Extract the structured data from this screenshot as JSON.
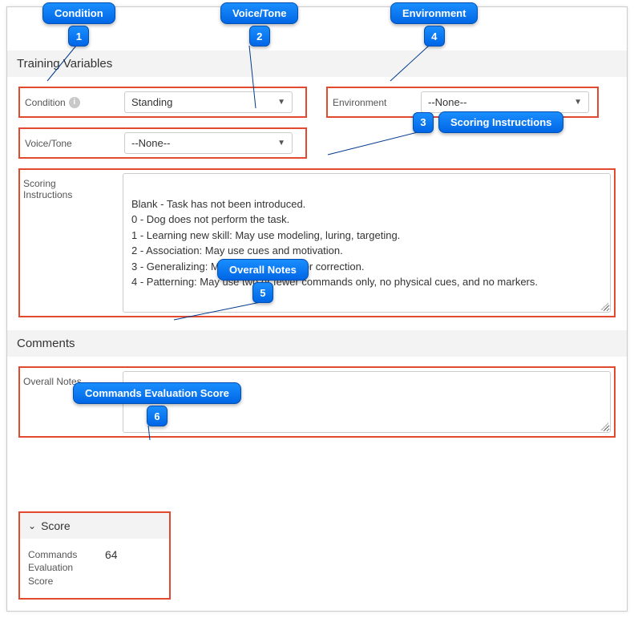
{
  "callouts": {
    "c1": {
      "label": "Condition",
      "num": "1"
    },
    "c2": {
      "label": "Voice/Tone",
      "num": "2"
    },
    "c3": {
      "label": "Scoring Instructions",
      "num": "3"
    },
    "c4": {
      "label": "Environment",
      "num": "4"
    },
    "c5": {
      "label": "Overall Notes",
      "num": "5"
    },
    "c6": {
      "label": "Commands Evaluation Score",
      "num": "6"
    }
  },
  "sections": {
    "training_vars": {
      "title": "Training Variables",
      "fields": {
        "condition": {
          "label": "Condition",
          "value": "Standing"
        },
        "environment": {
          "label": "Environment",
          "value": "--None--"
        },
        "voice_tone": {
          "label": "Voice/Tone",
          "value": "--None--"
        },
        "scoring_instructions": {
          "label": "Scoring\nInstructions",
          "value": "Blank - Task has not been introduced.\n0 - Dog does not perform the task.\n1 - Learning new skill: May use modeling, luring, targeting.\n2 - Association: May use cues and motivation.\n3 - Generalizing: May use motivation or correction.\n4 - Patterning: May use two or fewer commands only, no physical cues, and no markers."
        }
      }
    },
    "comments": {
      "title": "Comments",
      "fields": {
        "overall_notes": {
          "label": "Overall Notes",
          "value": ""
        }
      }
    },
    "score": {
      "title": "Score",
      "fields": {
        "commands_eval": {
          "label": "Commands Evaluation Score",
          "value": "64"
        }
      }
    }
  }
}
